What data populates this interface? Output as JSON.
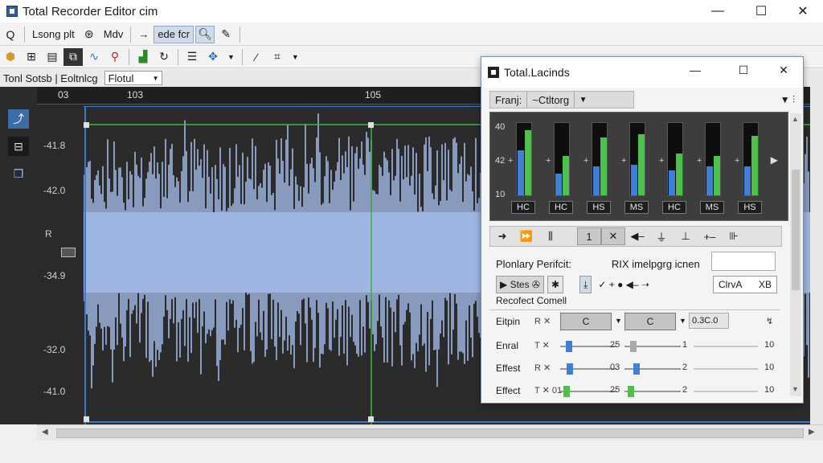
{
  "window": {
    "title": "Total Recorder Editor cim",
    "minimize": "—",
    "maximize": "☐",
    "close": "✕"
  },
  "toolbar1": {
    "search_icon": "Q",
    "btn_long": "Lsong plt",
    "btn_mdv": "Mdv",
    "arrow": "→",
    "btn_edit": "ede fcr"
  },
  "status": {
    "label": "Tonl Sotsb | Eoltnlcg",
    "mode": "Flotul"
  },
  "ruler": {
    "t1": "03",
    "t2": "103",
    "t3": "105"
  },
  "amplitude": [
    "-41.8",
    "-42.0",
    "R",
    "-34.9",
    "-32.0",
    "-41.0"
  ],
  "panel": {
    "title": "Total.Lacinds",
    "tab1": "Franj:",
    "tab2": "~Ctltorg",
    "scale": [
      "40",
      "42",
      "10"
    ],
    "meters": [
      {
        "name": "HC",
        "a": 0.62,
        "b": 0.9
      },
      {
        "name": "HC",
        "a": 0.3,
        "b": 0.55
      },
      {
        "name": "HS",
        "a": 0.4,
        "b": 0.8
      },
      {
        "name": "MS",
        "a": 0.42,
        "b": 0.85
      },
      {
        "name": "HC",
        "a": 0.35,
        "b": 0.58
      },
      {
        "name": "MS",
        "a": 0.4,
        "b": 0.55
      },
      {
        "name": "HS",
        "a": 0.4,
        "b": 0.82
      }
    ],
    "transport": [
      "➜",
      "⏩",
      "⫼",
      "1",
      "✕",
      "◀–",
      "⏚",
      "⊥",
      "+–",
      "⊪"
    ],
    "pp_label": "Plonlary Perifcit:",
    "pp_label2": "RIX imelpgrg icnen",
    "ctrl": {
      "btn1": "▶ Stes ✇",
      "btn2": "✱",
      "btn3": "⤓",
      "btn4": "✓ + ● ◀– ➝",
      "field": "ClrvA",
      "field_suffix": "XB"
    },
    "rc_label": "Recofect Comell",
    "params": [
      {
        "name": "Eitpin",
        "small": "R ✕",
        "combo1": "C",
        "combo2": "C",
        "field": "0.3C.0",
        "end": "↯",
        "knob1": 0.0,
        "knob2": 0.0,
        "n1": "",
        "n2": "",
        "n3": ""
      },
      {
        "name": "Enral",
        "small": "T ✕",
        "knob1": 0.1,
        "knob2": 0.1,
        "n1": "25",
        "n2": "1",
        "n3": "10",
        "combo1": "",
        "combo2": "",
        "field": "",
        "end": ""
      },
      {
        "name": "Effest",
        "small": "R ✕",
        "knob1": 0.12,
        "knob2": 0.15,
        "n1": "03",
        "n2": "2",
        "n3": "10",
        "combo1": "",
        "combo2": "",
        "field": "",
        "end": ""
      },
      {
        "name": "Effect",
        "small": "T ✕ 01",
        "knob1": 0.05,
        "knob2": 0.05,
        "n1": "25",
        "n2": "2",
        "n3": "10",
        "combo1": "",
        "combo2": "",
        "field": "",
        "end": ""
      }
    ]
  },
  "colors": {
    "wave": "#9fb6e3",
    "wave_edge": "#7a98d0",
    "select_line": "#3fb43f",
    "marker": "#3c78c8"
  }
}
